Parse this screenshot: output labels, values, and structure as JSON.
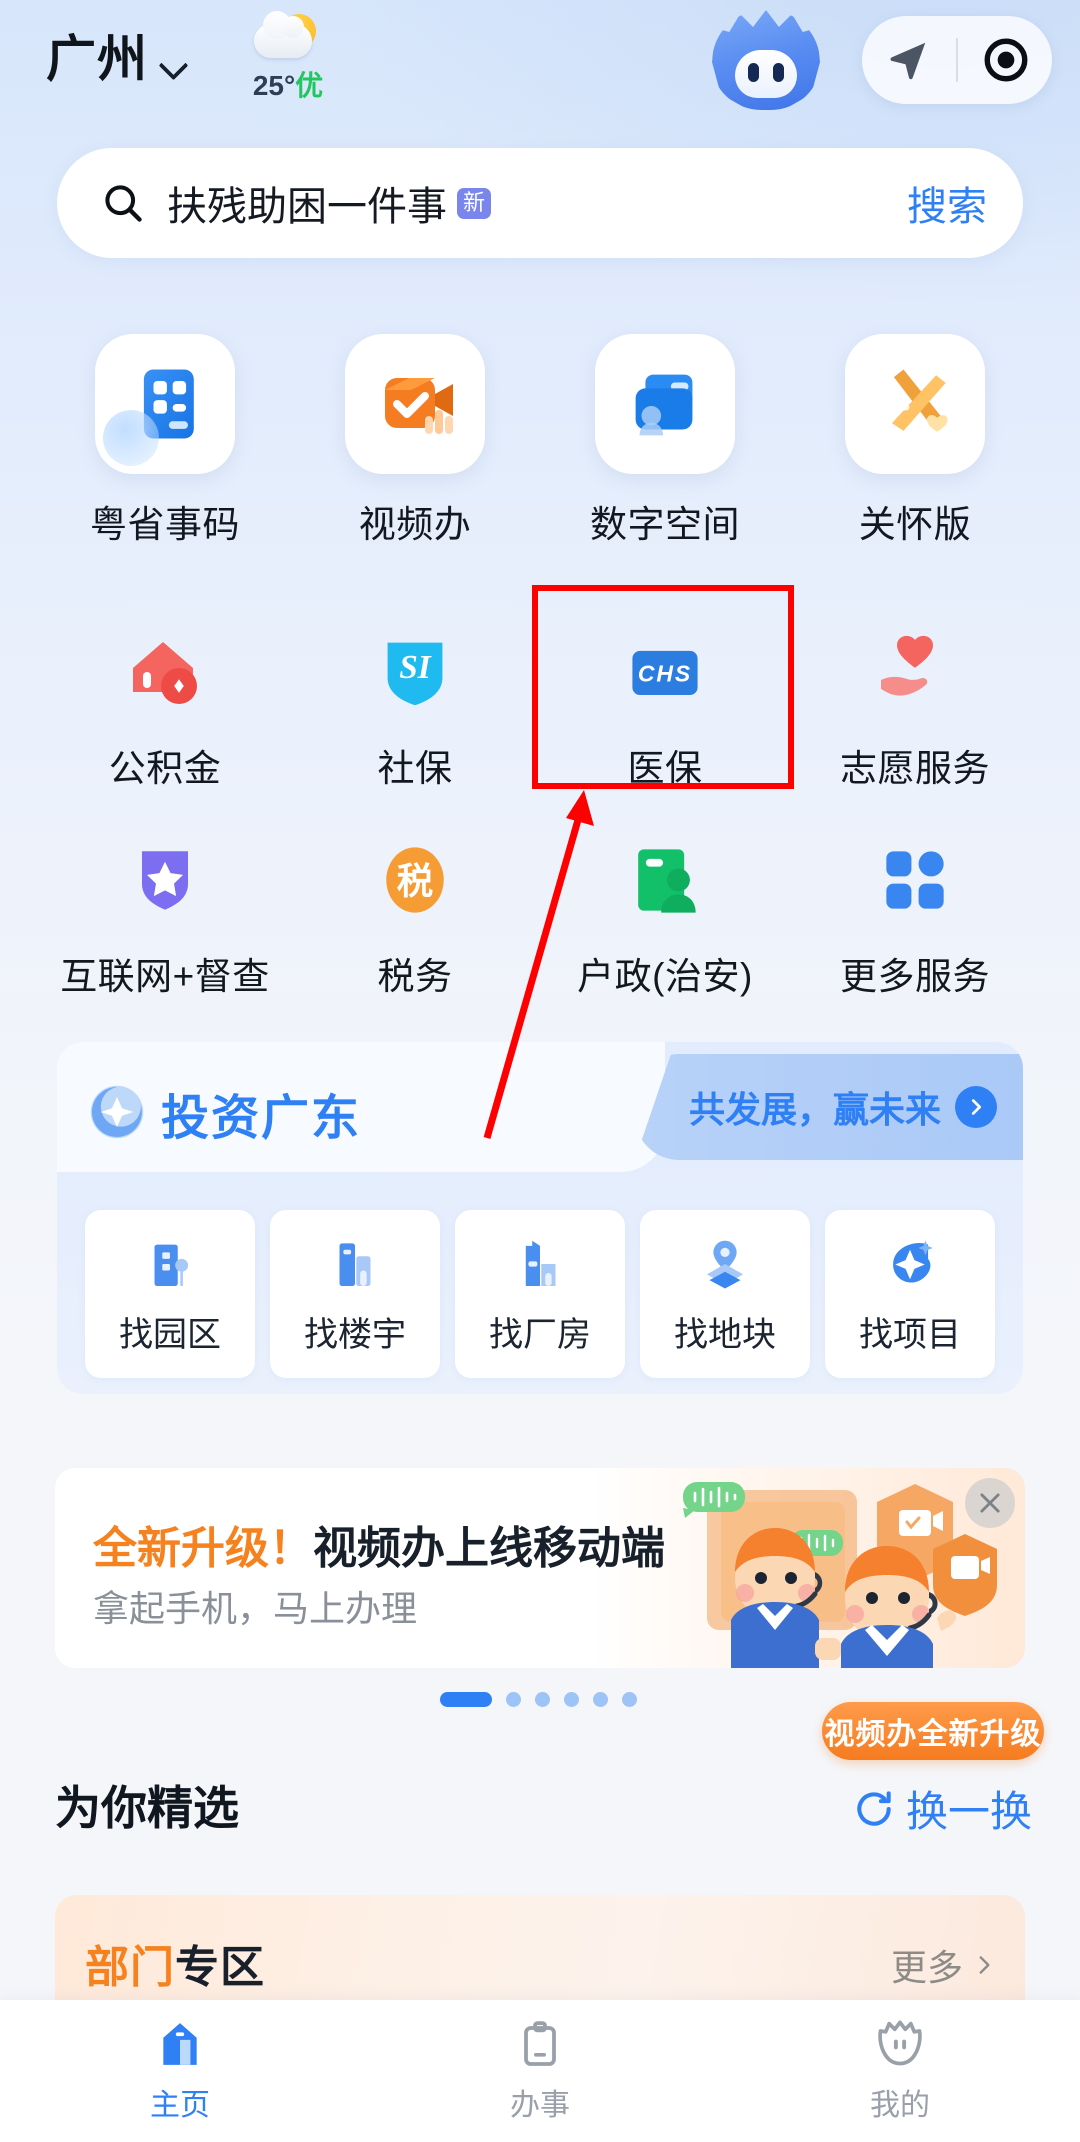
{
  "header": {
    "city": "广州",
    "city_chevron_icon": "chevron-down-icon",
    "weather_icon": "sun-behind-cloud-icon",
    "temperature": "25°",
    "air_quality": "优",
    "mascot_icon": "mascot-avatar-icon",
    "locate_icon": "navigation-arrow-icon",
    "scan_icon": "scan-target-icon"
  },
  "search": {
    "icon": "search-icon",
    "query": "扶残助困一件事",
    "badge": "新",
    "button_label": "搜索",
    "badge_color": "#7b86ec",
    "accent_color": "#2f7ff5"
  },
  "grid": {
    "row1": [
      {
        "label": "粤省事码",
        "icon": "qr-card-icon"
      },
      {
        "label": "视频办",
        "icon": "video-check-icon"
      },
      {
        "label": "数字空间",
        "icon": "digital-wallet-icon"
      },
      {
        "label": "关怀版",
        "icon": "care-ribbon-icon"
      }
    ],
    "row2": [
      {
        "label": "公积金",
        "icon": "house-coin-icon"
      },
      {
        "label": "社保",
        "icon": "si-shield-icon",
        "badge_text": "SI"
      },
      {
        "label": "医保",
        "icon": "chs-card-icon",
        "badge_text": "CHS",
        "highlighted": true
      },
      {
        "label": "志愿服务",
        "icon": "heart-in-hand-icon"
      }
    ],
    "row3": [
      {
        "label": "互联网+督查",
        "icon": "star-shield-icon"
      },
      {
        "label": "税务",
        "icon": "tax-circle-icon",
        "badge_text": "税"
      },
      {
        "label": "户政(治安)",
        "icon": "id-card-person-icon"
      },
      {
        "label": "更多服务",
        "icon": "grid-more-icon"
      }
    ]
  },
  "annotation": {
    "highlight_color": "#ff0000",
    "arrow_icon": "red-pointer-arrow",
    "target_label": "医保"
  },
  "invest": {
    "logo_icon": "invest-swirl-icon",
    "title": "投资广东",
    "tag_text": "共发展，赢未来",
    "tag_chevron_icon": "chevron-right-icon",
    "items": [
      {
        "label": "找园区",
        "icon": "park-building-icon"
      },
      {
        "label": "找楼宇",
        "icon": "office-tower-icon"
      },
      {
        "label": "找厂房",
        "icon": "factory-icon"
      },
      {
        "label": "找地块",
        "icon": "map-pin-land-icon"
      },
      {
        "label": "找项目",
        "icon": "project-spark-icon"
      }
    ]
  },
  "promo": {
    "title_highlight": "全新升级！",
    "title_rest": "视频办上线移动端",
    "subtitle": "拿起手机，马上办理",
    "close_icon": "close-icon",
    "badge_text": "视频办全新升级",
    "art_icon": "video-agents-illustration",
    "highlight_color": "#f5821f",
    "dots_total": 6,
    "dots_active_index": 0
  },
  "featured": {
    "title": "为你精选",
    "refresh_icon": "refresh-icon",
    "refresh_label": "换一换",
    "dept_card": {
      "title_highlight": "部门",
      "title_rest": "专区",
      "more_label": "更多",
      "more_icon": "chevron-right-icon"
    }
  },
  "bottom_nav": {
    "items": [
      {
        "label": "主页",
        "icon": "home-icon",
        "active": true
      },
      {
        "label": "办事",
        "icon": "clipboard-icon",
        "active": false
      },
      {
        "label": "我的",
        "icon": "profile-avatar-icon",
        "active": false
      }
    ],
    "active_color": "#2f7ff5",
    "inactive_color": "#9aa0aa"
  }
}
